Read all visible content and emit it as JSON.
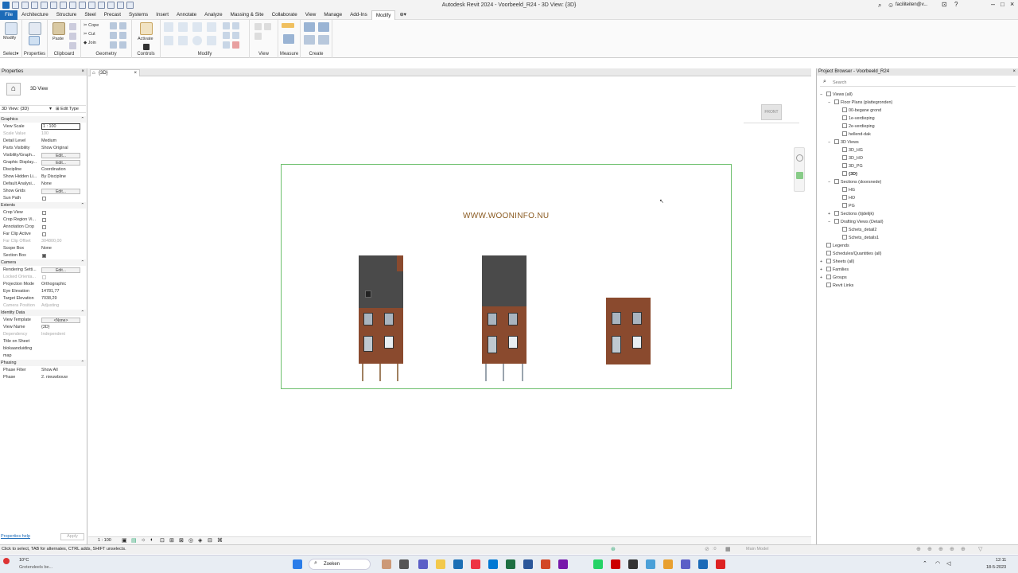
{
  "app": {
    "title": "Autodesk Revit 2024 - Voorbeeld_R24 - 3D View: {3D}",
    "user": "faciliteiten@v...",
    "colors": {
      "accent": "#1c6bb8",
      "crop_border": "#6cbf6c",
      "brick": "#8a4a2e",
      "roof": "#4a4a4a",
      "watermark": "#8a5a20"
    }
  },
  "menu": {
    "items": [
      "File",
      "Architecture",
      "Structure",
      "Steel",
      "Precast",
      "Systems",
      "Insert",
      "Annotate",
      "Analyze",
      "Massing & Site",
      "Collaborate",
      "View",
      "Manage",
      "Add-Ins",
      "Modify"
    ],
    "active": "Modify"
  },
  "ribbon": {
    "groups": {
      "select": "Select",
      "properties": "Properties",
      "clipboard": "Clipboard",
      "geometry": "Geometry",
      "controls": "Controls",
      "modify": "Modify",
      "view": "View",
      "measure": "Measure",
      "create": "Create"
    },
    "modify_label": "Modify",
    "paste_label": "Paste",
    "cope": "Cope",
    "cut": "Cut",
    "join": "Join",
    "activate": "Activate",
    "select_arrow": "▾"
  },
  "view_tab": {
    "label": "{3D}"
  },
  "properties": {
    "title": "Properties",
    "type_name": "3D View",
    "selector": "3D View: {3D}",
    "edit_type": "Edit Type",
    "sections": {
      "graphics": "Graphics",
      "extents": "Extents",
      "camera": "Camera",
      "identity": "Identity Data",
      "phasing": "Phasing"
    },
    "rows": {
      "view_scale": [
        "View Scale",
        "1 : 100"
      ],
      "scale_value": [
        "Scale Value",
        "100"
      ],
      "detail_level": [
        "Detail Level",
        "Medium"
      ],
      "parts_visibility": [
        "Parts Visibility",
        "Show Original"
      ],
      "visibility_graph": [
        "Visibility/Graph...",
        "Edit..."
      ],
      "graphic_display": [
        "Graphic Display...",
        "Edit..."
      ],
      "discipline": [
        "Discipline",
        "Coordination"
      ],
      "show_hidden": [
        "Show Hidden Li...",
        "By Discipline"
      ],
      "default_analysis": [
        "Default Analysi...",
        "None"
      ],
      "show_grids": [
        "Show Grids",
        "Edit..."
      ],
      "sun_path": [
        "Sun Path",
        ""
      ],
      "crop_view": [
        "Crop View",
        ""
      ],
      "crop_region": [
        "Crop Region Vi...",
        ""
      ],
      "annotation_crop": [
        "Annotation Crop",
        ""
      ],
      "far_clip_active": [
        "Far Clip Active",
        ""
      ],
      "far_clip_offset": [
        "Far Clip Offset",
        "304800,00"
      ],
      "scope_box": [
        "Scope Box",
        "None"
      ],
      "section_box": [
        "Section Box",
        ""
      ],
      "rendering": [
        "Rendering Setti...",
        "Edit..."
      ],
      "locked_orient": [
        "Locked Orienta...",
        ""
      ],
      "projection_mode": [
        "Projection Mode",
        "Orthographic"
      ],
      "eye_elevation": [
        "Eye Elevation",
        "14781,77"
      ],
      "target_elevation": [
        "Target Elevation",
        "7038,29"
      ],
      "camera_position": [
        "Camera Position",
        "Adjusting"
      ],
      "view_template": [
        "View Template",
        "<None>"
      ],
      "view_name": [
        "View Name",
        "{3D}"
      ],
      "dependency": [
        "Dependency",
        "Independent"
      ],
      "title_on_sheet": [
        "Title on Sheet",
        ""
      ],
      "bloknaam": [
        "blokaanduiding",
        ""
      ],
      "map": [
        "map",
        ""
      ],
      "phase_filter": [
        "Phase Filter",
        "Show All"
      ],
      "phase": [
        "Phase",
        "2. nieuwbouw"
      ]
    },
    "help": "Properties help",
    "apply": "Apply"
  },
  "canvas": {
    "watermark": "WWW.WOONINFO.NU",
    "viewcube_label": "FRONT"
  },
  "project_browser": {
    "title": "Project Browser - Voorbeeld_R24",
    "search_placeholder": "Search",
    "items": [
      {
        "label": "Views (all)",
        "level": 0,
        "toggle": "−"
      },
      {
        "label": "Floor Plans (plattegronden)",
        "level": 1,
        "toggle": "−"
      },
      {
        "label": "00-begane grond",
        "level": 2,
        "toggle": ""
      },
      {
        "label": "1e-verdieping",
        "level": 2,
        "toggle": ""
      },
      {
        "label": "2e-verdieping",
        "level": 2,
        "toggle": ""
      },
      {
        "label": "hellend-dak",
        "level": 2,
        "toggle": ""
      },
      {
        "label": "3D Views",
        "level": 1,
        "toggle": "−"
      },
      {
        "label": "3D_HG",
        "level": 2,
        "toggle": ""
      },
      {
        "label": "3D_HO",
        "level": 2,
        "toggle": ""
      },
      {
        "label": "3D_PG",
        "level": 2,
        "toggle": ""
      },
      {
        "label": "{3D}",
        "level": 2,
        "toggle": "",
        "bold": true
      },
      {
        "label": "Sections (doorsnede)",
        "level": 1,
        "toggle": "−"
      },
      {
        "label": "HG",
        "level": 2,
        "toggle": ""
      },
      {
        "label": "HO",
        "level": 2,
        "toggle": ""
      },
      {
        "label": "PG",
        "level": 2,
        "toggle": ""
      },
      {
        "label": "Sections (tijdelijk)",
        "level": 1,
        "toggle": "+"
      },
      {
        "label": "Drafting Views (Detail)",
        "level": 1,
        "toggle": "−"
      },
      {
        "label": "Schets_detail2",
        "level": 2,
        "toggle": ""
      },
      {
        "label": "Schets_details1",
        "level": 2,
        "toggle": ""
      },
      {
        "label": "Legends",
        "level": 0,
        "toggle": ""
      },
      {
        "label": "Schedules/Quantities (all)",
        "level": 0,
        "toggle": ""
      },
      {
        "label": "Sheets (all)",
        "level": 0,
        "toggle": "+"
      },
      {
        "label": "Families",
        "level": 0,
        "toggle": "+"
      },
      {
        "label": "Groups",
        "level": 0,
        "toggle": "+"
      },
      {
        "label": "Revit Links",
        "level": 0,
        "toggle": ""
      }
    ]
  },
  "view_control": {
    "scale": "1 : 100"
  },
  "status": {
    "hint": "Click to select, TAB for alternates, CTRL adds, SHIFT unselects.",
    "model": "Main Model",
    "sel_count": ":0"
  },
  "taskbar": {
    "weather_temp": "10°C",
    "weather_desc": "Grotendeels be...",
    "search": "Zoeken",
    "time": "12:11",
    "date": "18-5-2023"
  }
}
